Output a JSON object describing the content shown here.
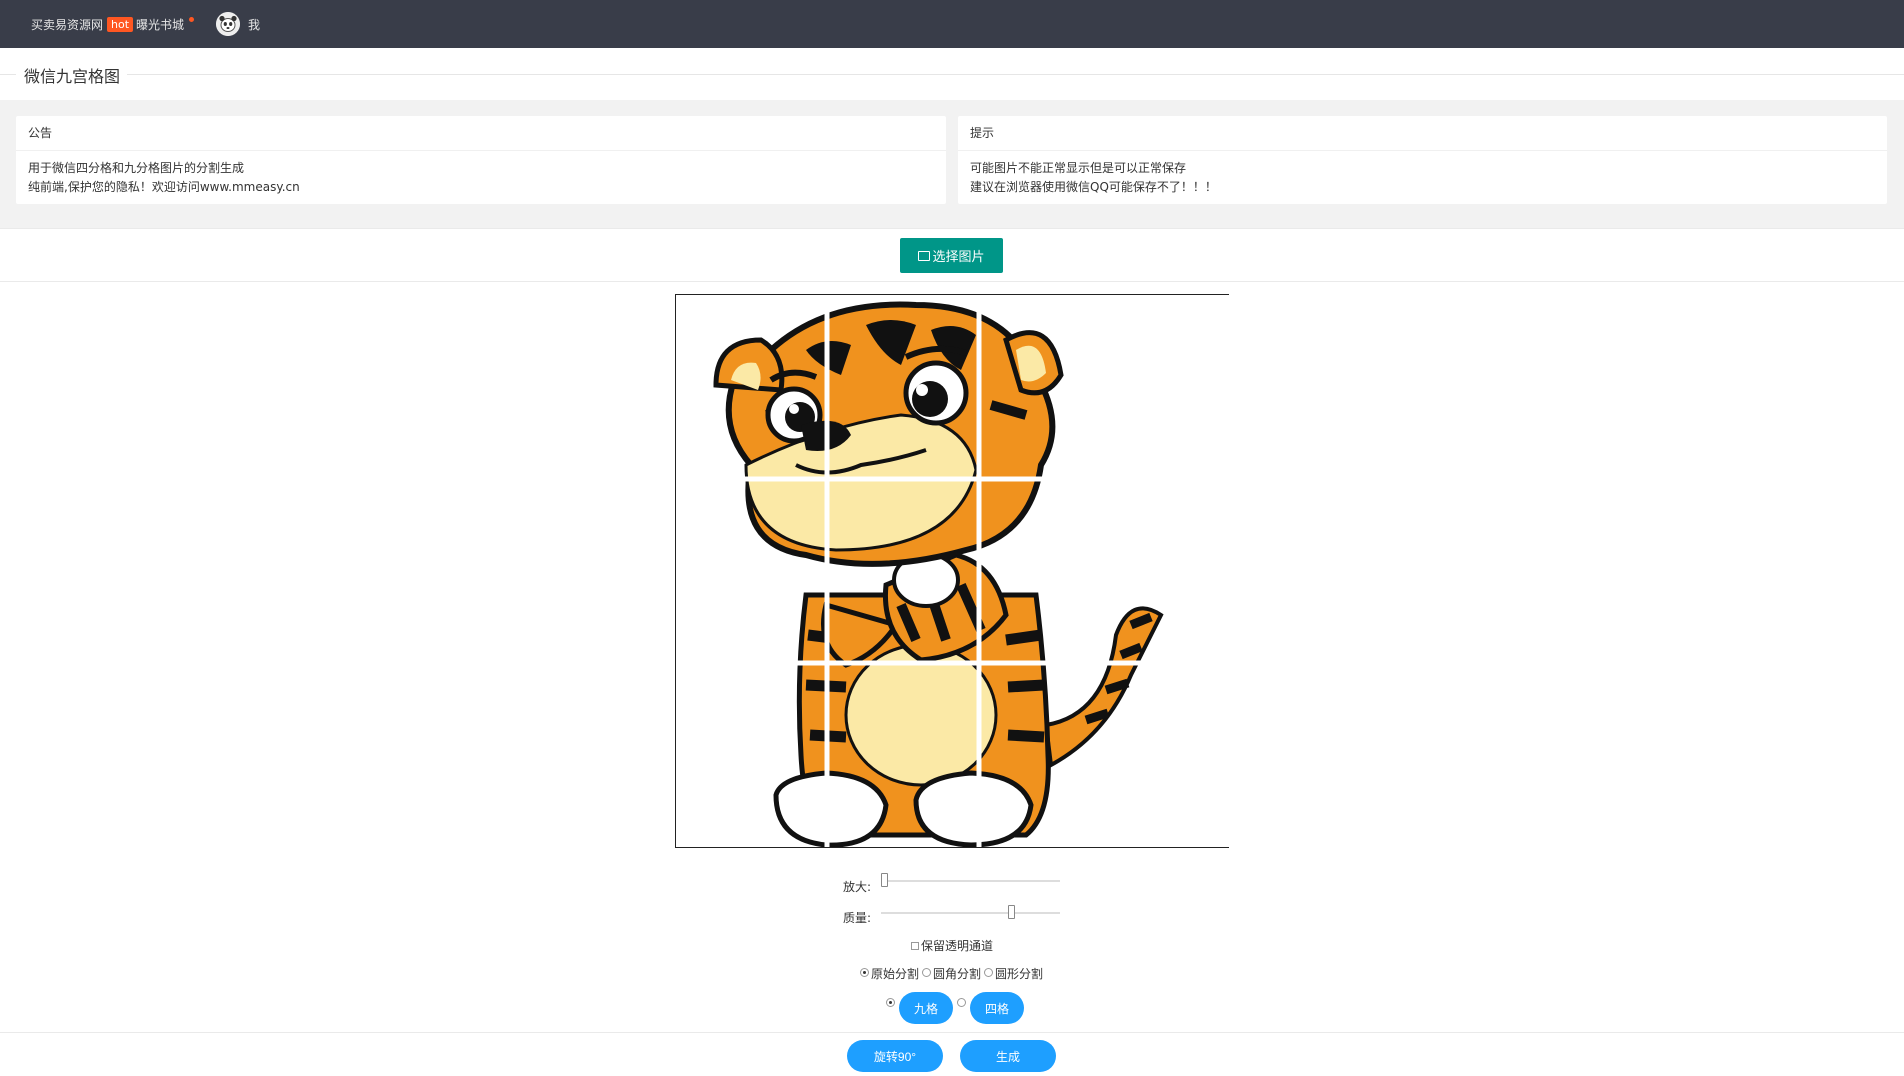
{
  "topbar": {
    "site_link": "买卖易资源网",
    "hot_badge": "hot",
    "book_link": "曝光书城",
    "user_label": "我"
  },
  "page_title": "微信九宫格图",
  "notice": {
    "title": "公告",
    "line1": "用于微信四分格和九分格图片的分割生成",
    "line2": "纯前端,保护您的隐私！欢迎访问www.mmeasy.cn"
  },
  "tip": {
    "title": "提示",
    "line1": "可能图片不能正常显示但是可以正常保存",
    "line2": "建议在浏览器使用微信QQ可能保存不了！！！"
  },
  "select_button": "选择图片",
  "controls": {
    "zoom_label": "放大:",
    "zoom_value": 0,
    "quality_label": "质量:",
    "quality_value": 0.74,
    "keep_alpha_label": "保留透明通道",
    "split_modes": [
      "原始分割",
      "圆角分割",
      "圆形分割"
    ],
    "grid_nine": "九格",
    "grid_four": "四格",
    "rotate_button": "旋转90°",
    "generate_button": "生成"
  },
  "colors": {
    "topbar_bg": "#393d49",
    "select_button_bg": "#009688",
    "pill_bg": "#1e9fff",
    "hot_badge_bg": "#ff5722"
  }
}
